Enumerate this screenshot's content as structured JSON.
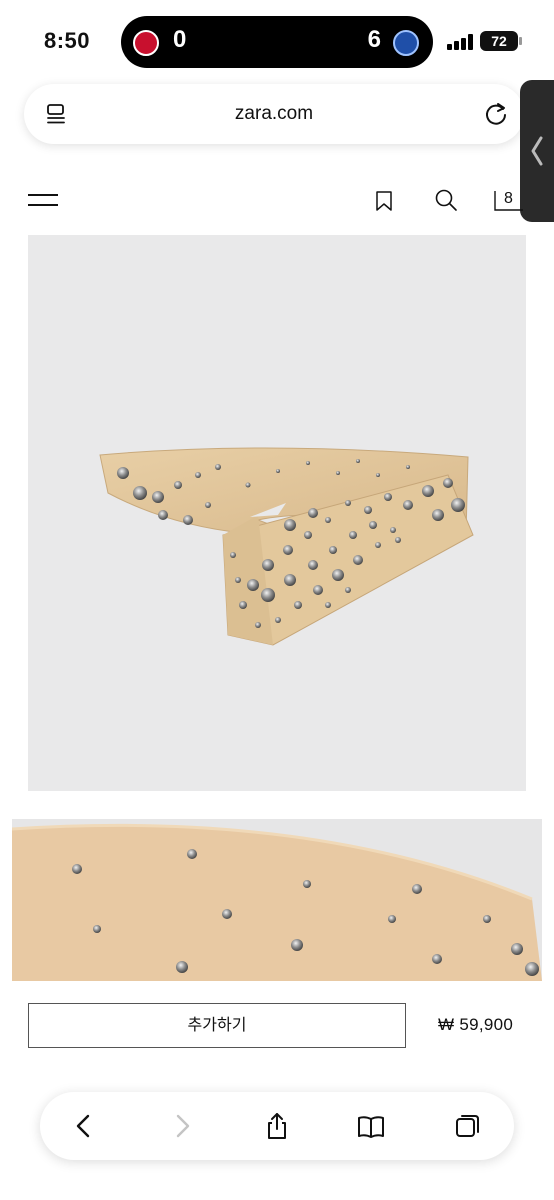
{
  "status_bar": {
    "time": "8:50",
    "score_left": "0",
    "score_right": "6",
    "battery": "72"
  },
  "browser": {
    "url": "zara.com"
  },
  "header": {
    "bag_count": "8"
  },
  "product": {
    "add_button_label": "추가하기",
    "price": "₩ 59,900"
  },
  "icons": [
    "menu-icon",
    "bookmark-icon",
    "search-icon",
    "bag-icon",
    "reload-icon",
    "tabs-icon",
    "back-icon",
    "forward-icon",
    "share-icon",
    "book-icon",
    "tabs-overview-icon"
  ]
}
